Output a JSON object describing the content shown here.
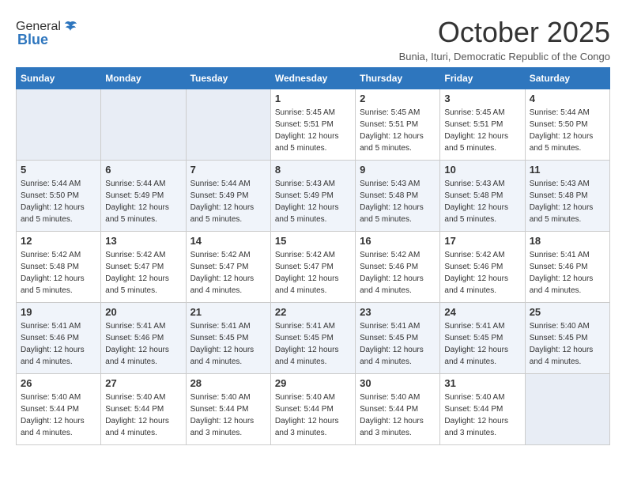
{
  "logo": {
    "general": "General",
    "blue": "Blue"
  },
  "header": {
    "month_title": "October 2025",
    "subtitle": "Bunia, Ituri, Democratic Republic of the Congo"
  },
  "weekdays": [
    "Sunday",
    "Monday",
    "Tuesday",
    "Wednesday",
    "Thursday",
    "Friday",
    "Saturday"
  ],
  "weeks": [
    [
      {
        "day": "",
        "info": ""
      },
      {
        "day": "",
        "info": ""
      },
      {
        "day": "",
        "info": ""
      },
      {
        "day": "1",
        "info": "Sunrise: 5:45 AM\nSunset: 5:51 PM\nDaylight: 12 hours\nand 5 minutes."
      },
      {
        "day": "2",
        "info": "Sunrise: 5:45 AM\nSunset: 5:51 PM\nDaylight: 12 hours\nand 5 minutes."
      },
      {
        "day": "3",
        "info": "Sunrise: 5:45 AM\nSunset: 5:51 PM\nDaylight: 12 hours\nand 5 minutes."
      },
      {
        "day": "4",
        "info": "Sunrise: 5:44 AM\nSunset: 5:50 PM\nDaylight: 12 hours\nand 5 minutes."
      }
    ],
    [
      {
        "day": "5",
        "info": "Sunrise: 5:44 AM\nSunset: 5:50 PM\nDaylight: 12 hours\nand 5 minutes."
      },
      {
        "day": "6",
        "info": "Sunrise: 5:44 AM\nSunset: 5:49 PM\nDaylight: 12 hours\nand 5 minutes."
      },
      {
        "day": "7",
        "info": "Sunrise: 5:44 AM\nSunset: 5:49 PM\nDaylight: 12 hours\nand 5 minutes."
      },
      {
        "day": "8",
        "info": "Sunrise: 5:43 AM\nSunset: 5:49 PM\nDaylight: 12 hours\nand 5 minutes."
      },
      {
        "day": "9",
        "info": "Sunrise: 5:43 AM\nSunset: 5:48 PM\nDaylight: 12 hours\nand 5 minutes."
      },
      {
        "day": "10",
        "info": "Sunrise: 5:43 AM\nSunset: 5:48 PM\nDaylight: 12 hours\nand 5 minutes."
      },
      {
        "day": "11",
        "info": "Sunrise: 5:43 AM\nSunset: 5:48 PM\nDaylight: 12 hours\nand 5 minutes."
      }
    ],
    [
      {
        "day": "12",
        "info": "Sunrise: 5:42 AM\nSunset: 5:48 PM\nDaylight: 12 hours\nand 5 minutes."
      },
      {
        "day": "13",
        "info": "Sunrise: 5:42 AM\nSunset: 5:47 PM\nDaylight: 12 hours\nand 5 minutes."
      },
      {
        "day": "14",
        "info": "Sunrise: 5:42 AM\nSunset: 5:47 PM\nDaylight: 12 hours\nand 4 minutes."
      },
      {
        "day": "15",
        "info": "Sunrise: 5:42 AM\nSunset: 5:47 PM\nDaylight: 12 hours\nand 4 minutes."
      },
      {
        "day": "16",
        "info": "Sunrise: 5:42 AM\nSunset: 5:46 PM\nDaylight: 12 hours\nand 4 minutes."
      },
      {
        "day": "17",
        "info": "Sunrise: 5:42 AM\nSunset: 5:46 PM\nDaylight: 12 hours\nand 4 minutes."
      },
      {
        "day": "18",
        "info": "Sunrise: 5:41 AM\nSunset: 5:46 PM\nDaylight: 12 hours\nand 4 minutes."
      }
    ],
    [
      {
        "day": "19",
        "info": "Sunrise: 5:41 AM\nSunset: 5:46 PM\nDaylight: 12 hours\nand 4 minutes."
      },
      {
        "day": "20",
        "info": "Sunrise: 5:41 AM\nSunset: 5:46 PM\nDaylight: 12 hours\nand 4 minutes."
      },
      {
        "day": "21",
        "info": "Sunrise: 5:41 AM\nSunset: 5:45 PM\nDaylight: 12 hours\nand 4 minutes."
      },
      {
        "day": "22",
        "info": "Sunrise: 5:41 AM\nSunset: 5:45 PM\nDaylight: 12 hours\nand 4 minutes."
      },
      {
        "day": "23",
        "info": "Sunrise: 5:41 AM\nSunset: 5:45 PM\nDaylight: 12 hours\nand 4 minutes."
      },
      {
        "day": "24",
        "info": "Sunrise: 5:41 AM\nSunset: 5:45 PM\nDaylight: 12 hours\nand 4 minutes."
      },
      {
        "day": "25",
        "info": "Sunrise: 5:40 AM\nSunset: 5:45 PM\nDaylight: 12 hours\nand 4 minutes."
      }
    ],
    [
      {
        "day": "26",
        "info": "Sunrise: 5:40 AM\nSunset: 5:44 PM\nDaylight: 12 hours\nand 4 minutes."
      },
      {
        "day": "27",
        "info": "Sunrise: 5:40 AM\nSunset: 5:44 PM\nDaylight: 12 hours\nand 4 minutes."
      },
      {
        "day": "28",
        "info": "Sunrise: 5:40 AM\nSunset: 5:44 PM\nDaylight: 12 hours\nand 3 minutes."
      },
      {
        "day": "29",
        "info": "Sunrise: 5:40 AM\nSunset: 5:44 PM\nDaylight: 12 hours\nand 3 minutes."
      },
      {
        "day": "30",
        "info": "Sunrise: 5:40 AM\nSunset: 5:44 PM\nDaylight: 12 hours\nand 3 minutes."
      },
      {
        "day": "31",
        "info": "Sunrise: 5:40 AM\nSunset: 5:44 PM\nDaylight: 12 hours\nand 3 minutes."
      },
      {
        "day": "",
        "info": ""
      }
    ]
  ]
}
